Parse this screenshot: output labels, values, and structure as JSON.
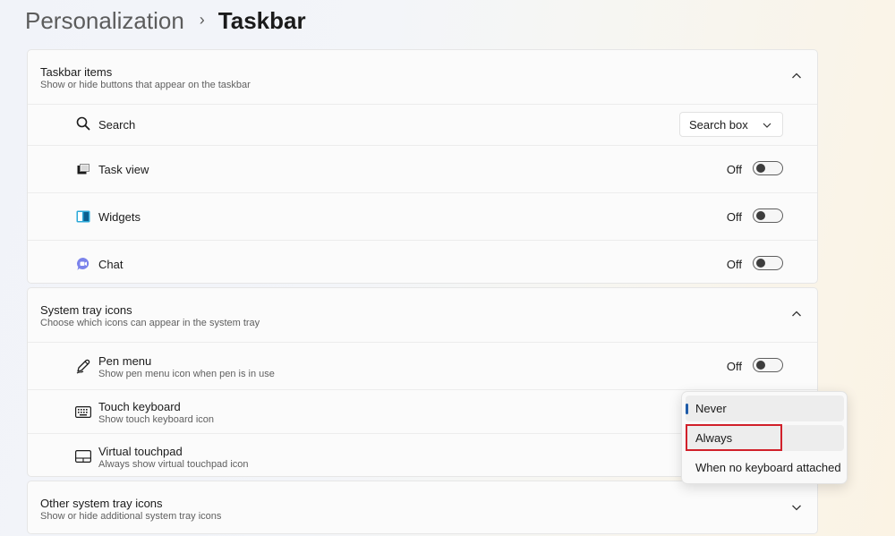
{
  "breadcrumb": {
    "parent": "Personalization",
    "separator": "›",
    "current": "Taskbar"
  },
  "taskbar_items": {
    "title": "Taskbar items",
    "subtitle": "Show or hide buttons that appear on the taskbar",
    "rows": [
      {
        "label": "Search",
        "control": "dropdown",
        "value": "Search box",
        "icon": "search-icon"
      },
      {
        "label": "Task view",
        "control": "toggle",
        "state": "Off",
        "icon": "task-view-icon"
      },
      {
        "label": "Widgets",
        "control": "toggle",
        "state": "Off",
        "icon": "widgets-icon"
      },
      {
        "label": "Chat",
        "control": "toggle",
        "state": "Off",
        "icon": "chat-icon"
      }
    ]
  },
  "system_tray": {
    "title": "System tray icons",
    "subtitle": "Choose which icons can appear in the system tray",
    "rows": [
      {
        "label": "Pen menu",
        "sub": "Show pen menu icon when pen is in use",
        "control": "toggle",
        "state": "Off",
        "icon": "pen-icon"
      },
      {
        "label": "Touch keyboard",
        "sub": "Show touch keyboard icon",
        "icon": "keyboard-icon"
      },
      {
        "label": "Virtual touchpad",
        "sub": "Always show virtual touchpad icon",
        "icon": "touchpad-icon"
      }
    ]
  },
  "other_tray": {
    "title": "Other system tray icons",
    "subtitle": "Show or hide additional system tray icons"
  },
  "flyout": {
    "options": [
      "Never",
      "Always",
      "When no keyboard attached"
    ],
    "selected": "Never",
    "highlighted": "Always"
  },
  "colors": {
    "accent": "#1f5ba8",
    "highlight_border": "#d1202a"
  }
}
